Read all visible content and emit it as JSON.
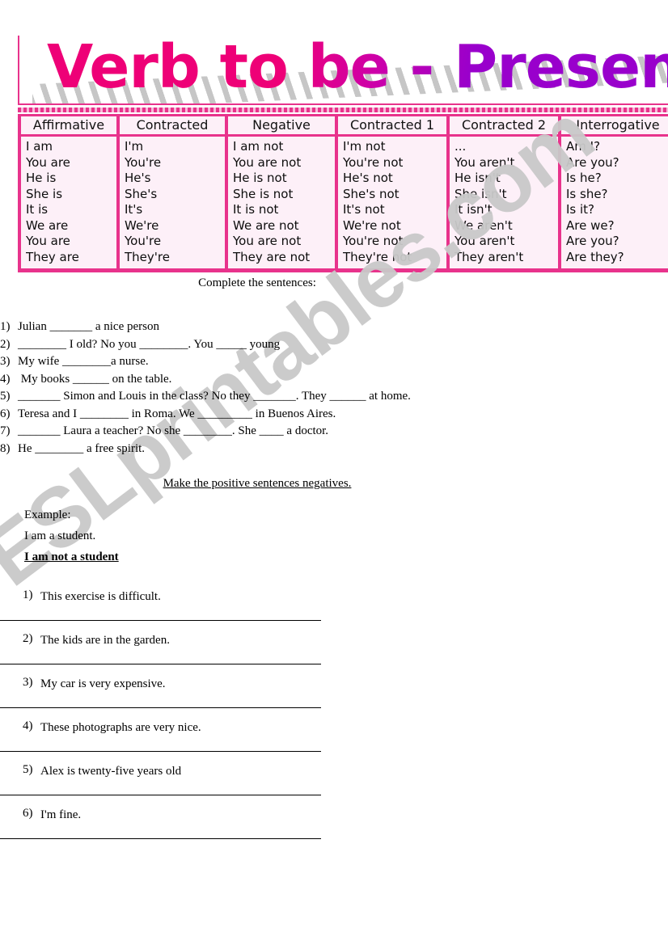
{
  "title": "Verb to be - Present",
  "watermark": "ESLprintables.com",
  "colors": {
    "accent_pink": "#e8338c",
    "title_left": "#ee0077",
    "title_right": "#9900cc",
    "cell_background": "#fdf0f8",
    "watermark_gray": "#c9c9c9"
  },
  "table": {
    "headers": [
      "Affirmative",
      "Contracted",
      "Negative",
      "Contracted 1",
      "Contracted 2",
      "Interrogative"
    ],
    "columns": [
      [
        "I am",
        "You are",
        "He is",
        "She is",
        "It is",
        "We are",
        "You are",
        "They are"
      ],
      [
        "I'm",
        "You're",
        "He's",
        "She's",
        "It's",
        "We're",
        "You're",
        "They're"
      ],
      [
        "I am not",
        "You are not",
        "He is not",
        "She is not",
        "It is not",
        "We are not",
        "You are not",
        "They are not"
      ],
      [
        "I'm not",
        "You're not",
        "He's not",
        "She's not",
        "It's not",
        "We're not",
        "You're not",
        "They're not"
      ],
      [
        "...",
        "You aren't",
        "He isn't",
        "She isn't",
        "It isn't",
        "We aren't",
        "You aren't",
        "They aren't"
      ],
      [
        "Am I?",
        "Are you?",
        "Is he?",
        "Is she?",
        "Is it?",
        "Are we?",
        "Are you?",
        "Are they?"
      ]
    ]
  },
  "exercise1": {
    "instruction": "Complete the sentences:",
    "items": [
      {
        "num": "1)",
        "text": "Julian _______ a nice person"
      },
      {
        "num": "2)",
        "text": "________ I old? No you ________. You _____ young"
      },
      {
        "num": "3)",
        "text": "My wife ________a nurse."
      },
      {
        "num": "4)",
        "text": " My books ______ on the table."
      },
      {
        "num": "5)",
        "text": "_______ Simon and Louis in the class? No they _______. They ______ at home."
      },
      {
        "num": "6)",
        "text": "Teresa and I ________ in Roma. We _________ in Buenos Aires."
      },
      {
        "num": "7)",
        "text": "_______ Laura a teacher? No she ________. She ____ a doctor."
      },
      {
        "num": "8)",
        "text": "He ________ a free spirit."
      }
    ]
  },
  "exercise2": {
    "instruction": "Make the positive sentences negatives.",
    "example_label": "Example:",
    "example_positive": "I am a student.",
    "example_negative": "I am not a student",
    "items": [
      {
        "num": "1)",
        "text": "This exercise is difficult."
      },
      {
        "num": "2)",
        "text": "The kids are in the garden."
      },
      {
        "num": "3)",
        "text": "My car is very expensive."
      },
      {
        "num": "4)",
        "text": "These photographs are very nice."
      },
      {
        "num": "5)",
        "text": "Alex is twenty-five years old"
      },
      {
        "num": "6)",
        "text": "I'm fine."
      }
    ]
  }
}
